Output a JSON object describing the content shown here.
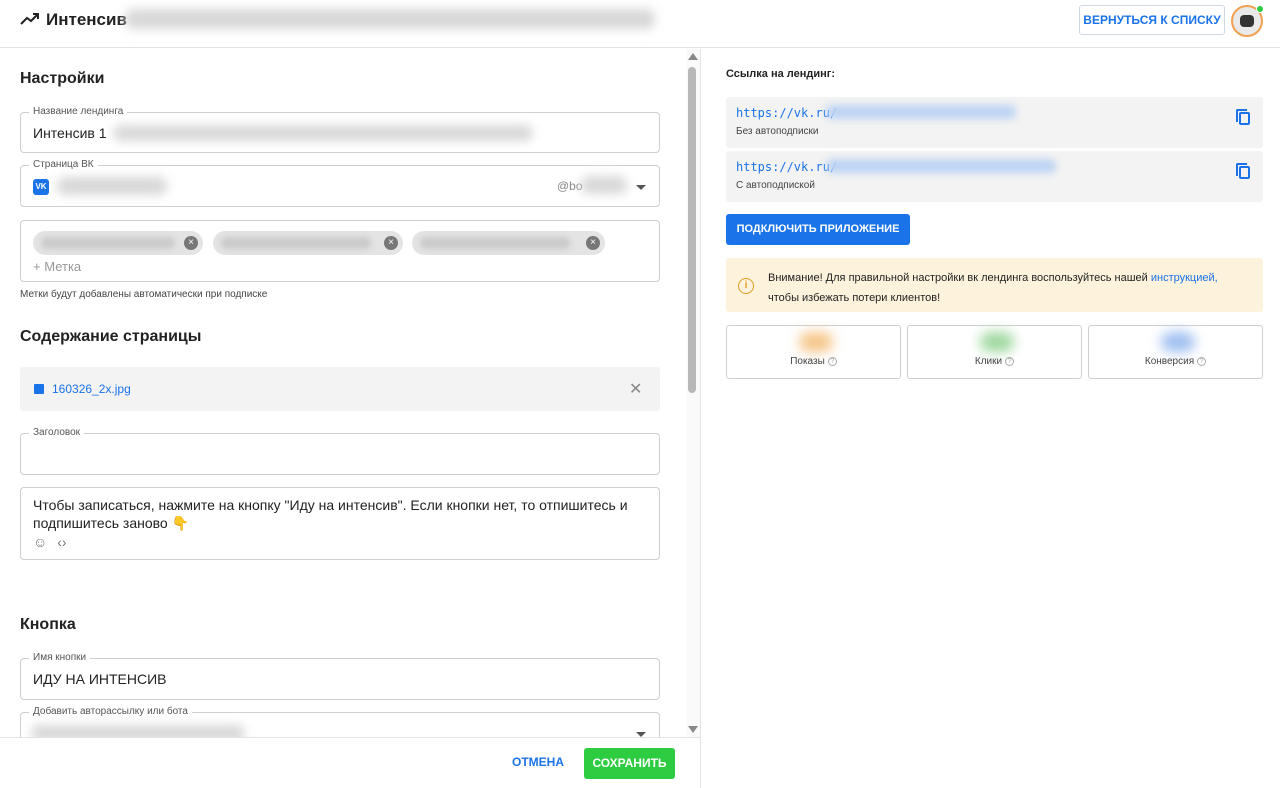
{
  "header": {
    "title": "Интенсив",
    "back_button": "ВЕРНУТЬСЯ К СПИСКУ"
  },
  "settings": {
    "section_title": "Настройки",
    "landing_name": {
      "label": "Название лендинга",
      "value": "Интенсив 1"
    },
    "vk_page": {
      "label": "Страница ВК",
      "vk_icon": "vk-icon",
      "at_handle": "@bo"
    },
    "tags": {
      "add_placeholder": "Метка",
      "hint": "Метки будут добавлены автоматически при подписке"
    }
  },
  "content": {
    "section_title": "Содержание страницы",
    "file_name": "160326_2x.jpg",
    "heading_field": {
      "label": "Заголовок",
      "value": ""
    },
    "text_field": {
      "value": "Чтобы записаться, нажмите на кнопку \"Иду на интенсив\". Если кнопки нет, то отпишитесь и подпишитесь заново 👇"
    }
  },
  "button_section": {
    "section_title": "Кнопка",
    "button_name": {
      "label": "Имя кнопки",
      "value": "ИДУ НА ИНТЕНСИВ"
    },
    "autoresponder": {
      "label": "Добавить авторассылку или бота"
    }
  },
  "footer": {
    "cancel": "ОТМЕНА",
    "save": "СОХРАНИТЬ"
  },
  "right": {
    "link_label": "Ссылка на лендинг:",
    "links": [
      {
        "url": "https://vk.ru/",
        "desc": "Без автоподписки"
      },
      {
        "url": "https://vk.ru/",
        "desc": "С автоподпиской"
      }
    ],
    "connect_button": "ПОДКЛЮЧИТЬ ПРИЛОЖЕНИЕ",
    "warning": {
      "text_before": "Внимание! Для правильной настройки вк лендинга воспользуйтесь нашей ",
      "link": "инструкцией,",
      "text_after": "чтобы избежать потери клиентов!"
    },
    "stats": [
      {
        "label": "Показы",
        "color": "#f5c68a"
      },
      {
        "label": "Клики",
        "color": "#9fd89f"
      },
      {
        "label": "Конверсия",
        "color": "#9fbff0"
      }
    ]
  },
  "colors": {
    "accent": "#1a73e8",
    "success": "#2ecc40",
    "warning_bg": "#fdf2dc"
  }
}
